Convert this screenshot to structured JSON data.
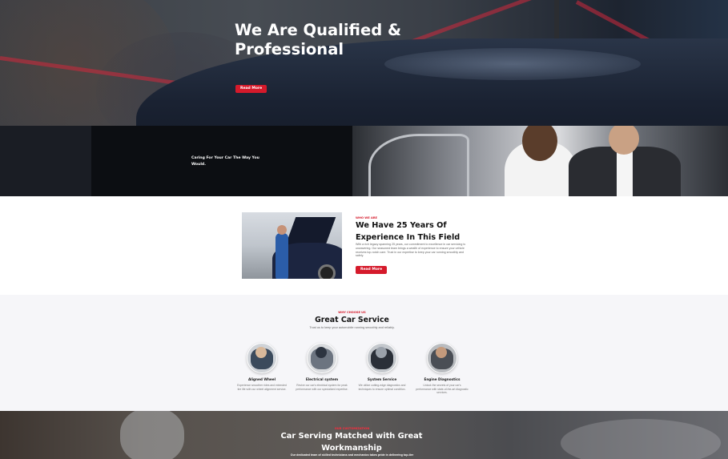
{
  "hero": {
    "title": "We Are Qualified & Professional",
    "button_label": "Read More"
  },
  "band": {
    "tagline": "Caring For Your Car The Way You Would."
  },
  "about": {
    "eyebrow": "WHO WE ARE",
    "title": "We Have 25 Years Of Experience In This Field",
    "paragraph": "With a rich legacy spanning 25 years, our commitment to excellence in car servicing is unwavering. Our seasoned team brings a wealth of experience to ensure your vehicle receives top-notch care. Trust in our expertise to keep your car running smoothly and safely.",
    "button_label": "Read More"
  },
  "services": {
    "eyebrow": "WHY CHOOSE US",
    "title": "Great Car Service",
    "subtitle": "Trust us to keep your automobile running smoothly and reliably.",
    "items": [
      {
        "name": "Aligned Wheel",
        "description": "Experience smoother rides and extended tire life with our wheel alignment service.",
        "icon": "wheel-alignment-photo"
      },
      {
        "name": "Electrical system",
        "description": "Revive our car's electrical system for peak performance with our specialized expertise.",
        "icon": "electrical-system-photo"
      },
      {
        "name": "System Service",
        "description": "We utilize cutting-edge diagnostics and techniques to ensure optimal condition.",
        "icon": "system-service-photo"
      },
      {
        "name": "Engine Diagnostics",
        "description": "Unlock the secrets of your car's performance with state-of-the-art diagnostic services.",
        "icon": "engine-diagnostics-photo"
      }
    ]
  },
  "cta": {
    "eyebrow": "OUR CUSTOMIZATION",
    "title": "Car Serving Matched with Great Workmanship",
    "paragraph": "Our dedicated team of skilled technicians and mechanics takes pride in delivering top-tier"
  },
  "colors": {
    "accent": "#d51a2b",
    "dark": "#0c0e12",
    "section_bg": "#f6f6f9"
  }
}
